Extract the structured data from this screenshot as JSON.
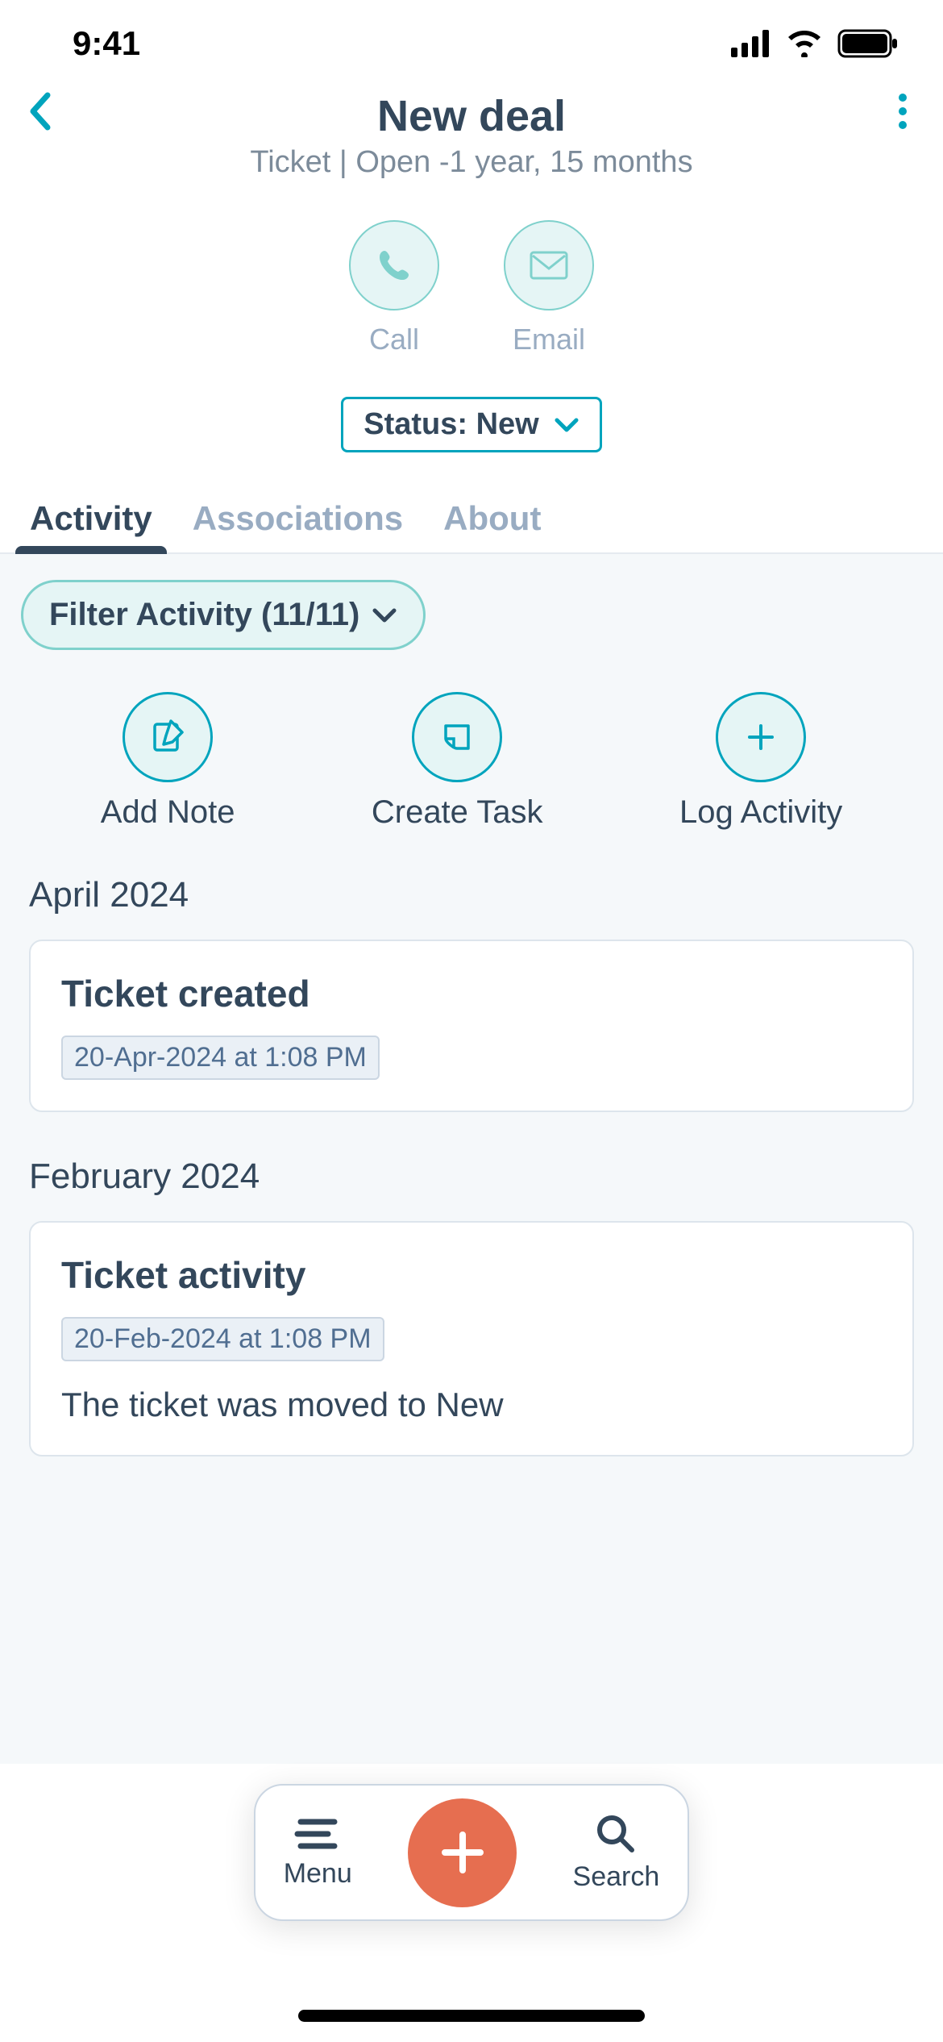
{
  "statusBar": {
    "time": "9:41"
  },
  "header": {
    "title": "New deal",
    "subtitle": "Ticket | Open -1 year, 15 months"
  },
  "quickActions": {
    "call": "Call",
    "email": "Email"
  },
  "status": {
    "label": "Status: New"
  },
  "tabs": {
    "activity": "Activity",
    "associations": "Associations",
    "about": "About"
  },
  "filter": {
    "label": "Filter Activity (11/11)"
  },
  "actions": {
    "addNote": "Add Note",
    "createTask": "Create Task",
    "logActivity": "Log Activity"
  },
  "months": {
    "april": "April 2024",
    "february": "February 2024"
  },
  "cards": {
    "ticketCreated": {
      "title": "Ticket created",
      "date": "20-Apr-2024 at 1:08 PM"
    },
    "ticketActivity": {
      "title": "Ticket activity",
      "date": "20-Feb-2024 at 1:08 PM",
      "body": "The ticket was moved to New"
    }
  },
  "bottomNav": {
    "menu": "Menu",
    "search": "Search"
  }
}
